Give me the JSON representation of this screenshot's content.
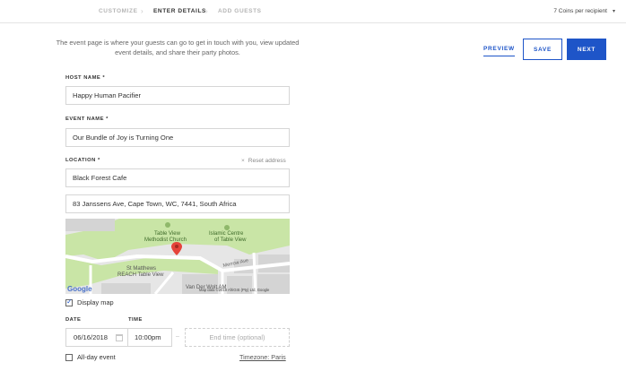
{
  "steps": [
    {
      "label": "CUSTOMIZE"
    },
    {
      "label": "ENTER DETAILS"
    },
    {
      "label": "ADD GUESTS"
    }
  ],
  "step_separator": "›",
  "coins": {
    "label": "7 Coins per recipient",
    "caret": "▾"
  },
  "intro_text": "The event page is where your guests can go to get in touch with you, view updated event details, and share their party photos.",
  "actions": {
    "preview": "PREVIEW",
    "save": "SAVE",
    "next": "NEXT"
  },
  "host": {
    "label": "HOST NAME *",
    "value": "Happy Human Pacifier"
  },
  "event": {
    "label": "EVENT NAME *",
    "value": "Our Bundle of Joy is Turning One"
  },
  "location": {
    "label": "LOCATION *",
    "reset_label": "Reset address",
    "reset_icon": "×",
    "venue": "Black Forest Cafe",
    "address": "83 Janssens Ave, Cape Town, WC, 7441, South Africa"
  },
  "map": {
    "labels": {
      "church_1": "Table View",
      "church_2": "Methodist Church",
      "islamic_1": "Islamic Centre",
      "islamic_2": "of Table View",
      "stmatthews_1": "St Matthews",
      "stmatthews_2": "REACH Table View",
      "road": "Merrow Ave",
      "vandeventer": "Van Der Wolt AM",
      "google": "Google",
      "attribution": "Map data ©2018 AfriGIS (Pty) Ltd, Google"
    },
    "colors": {
      "park": "#c9e5a6",
      "block": "#d4d4d4",
      "road": "#ffffff",
      "pin": "#e5433a"
    }
  },
  "display_map": {
    "label": "Display map",
    "checked": true
  },
  "date": {
    "label": "DATE",
    "value": "06/16/2018"
  },
  "time": {
    "label": "TIME",
    "value": "10:00pm"
  },
  "end_time": {
    "placeholder": "End time (optional)",
    "dash": "–"
  },
  "all_day": {
    "label": "All-day event",
    "checked": false
  },
  "timezone": {
    "label": "Timezone: Paris"
  },
  "colors": {
    "accent": "#1e55c8"
  }
}
